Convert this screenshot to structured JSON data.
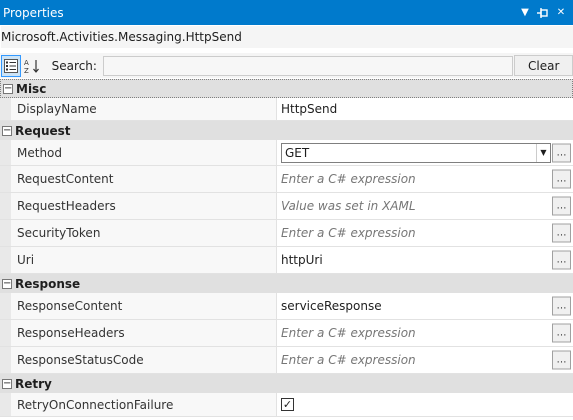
{
  "window": {
    "title": "Properties"
  },
  "type_name": "Microsoft.Activities.Messaging.HttpSend",
  "toolbar": {
    "search_label": "Search:",
    "search_value": "",
    "clear_label": "Clear"
  },
  "categories": [
    {
      "name": "Misc",
      "properties": [
        {
          "name": "DisplayName",
          "value": "HttpSend"
        }
      ]
    },
    {
      "name": "Request",
      "properties": [
        {
          "name": "Method",
          "value": "GET"
        },
        {
          "name": "RequestContent",
          "placeholder": "Enter a C# expression"
        },
        {
          "name": "RequestHeaders",
          "placeholder": "Value was set in XAML"
        },
        {
          "name": "SecurityToken",
          "placeholder": "Enter a C# expression"
        },
        {
          "name": "Uri",
          "value": "httpUri"
        }
      ]
    },
    {
      "name": "Response",
      "properties": [
        {
          "name": "ResponseContent",
          "value": "serviceResponse"
        },
        {
          "name": "ResponseHeaders",
          "placeholder": "Enter a C# expression"
        },
        {
          "name": "ResponseStatusCode",
          "placeholder": "Enter a C# expression"
        }
      ]
    },
    {
      "name": "Retry",
      "properties": [
        {
          "name": "RetryOnConnectionFailure",
          "checked": true
        }
      ]
    }
  ],
  "icons": {
    "dropdown": "dropdown-icon",
    "pin": "pin-icon",
    "close": "close-icon",
    "categorized": "categorized-icon",
    "alphabetical": "alphabetical-icon",
    "ellipsis": "ellipsis-icon",
    "collapse": "collapse-icon"
  },
  "colors": {
    "titlebar": "#007acc",
    "category_bg": "#e0e0e0"
  }
}
